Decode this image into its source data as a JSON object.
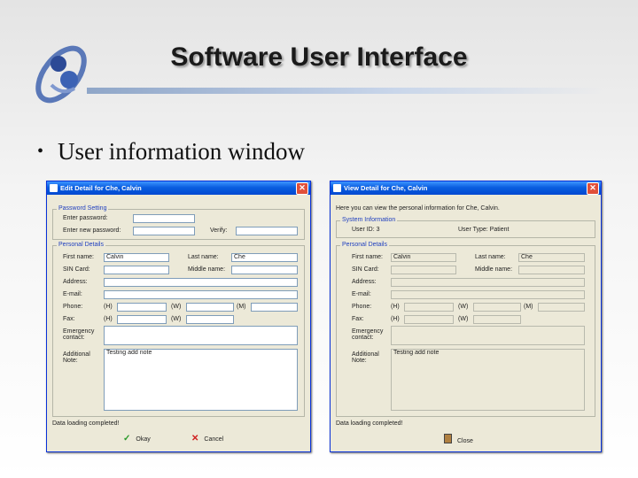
{
  "slide": {
    "title": "Software User Interface",
    "bullet": "User information window"
  },
  "edit_window": {
    "title": "Edit Detail for Che, Calvin",
    "close_glyph": "✕",
    "password_group": "Password Setting",
    "enter_password_label": "Enter password:",
    "enter_password_value": "",
    "new_password_label": "Enter new password:",
    "new_password_value": "",
    "verify_label": "Verify:",
    "verify_value": "",
    "personal_group": "Personal Details",
    "first_name_label": "First name:",
    "first_name_value": "Calvin",
    "last_name_label": "Last name:",
    "last_name_value": "Che",
    "sin_label": "SIN Card:",
    "sin_value": "",
    "middle_name_label": "Middle name:",
    "middle_name_value": "",
    "address_label": "Address:",
    "address_value": "",
    "email_label": "E-mail:",
    "email_value": "",
    "phone_label": "Phone:",
    "fax_label": "Fax:",
    "h_tag": "(H)",
    "w_tag": "(W)",
    "m_tag": "(M)",
    "phone_h_value": "",
    "phone_w_value": "",
    "phone_m_value": "",
    "fax_h_value": "",
    "fax_w_value": "",
    "emergency_label": "Emergency contact:",
    "emergency_value": "",
    "additional_label": "Additional Note:",
    "additional_value": "Testing add note",
    "status": "Data loading completed!",
    "okay_label": "Okay",
    "cancel_label": "Cancel"
  },
  "view_window": {
    "title": "View Detail for Che, Calvin",
    "close_glyph": "✕",
    "intro": "Here you can view the personal information for Che, Calvin.",
    "system_group": "System Information",
    "user_id_label": "User ID: 3",
    "user_type_label": "User Type: Patient",
    "personal_group": "Personal Details",
    "first_name_label": "First name:",
    "first_name_value": "Calvin",
    "last_name_label": "Last name:",
    "last_name_value": "Che",
    "sin_label": "SIN Card:",
    "sin_value": "",
    "middle_name_label": "Middle name:",
    "middle_name_value": "",
    "address_label": "Address:",
    "address_value": "",
    "email_label": "E-mail:",
    "email_value": "",
    "phone_label": "Phone:",
    "fax_label": "Fax:",
    "h_tag": "(H)",
    "w_tag": "(W)",
    "m_tag": "(M)",
    "phone_h_value": "",
    "phone_w_value": "",
    "phone_m_value": "",
    "fax_h_value": "",
    "fax_w_value": "",
    "emergency_label": "Emergency contact:",
    "emergency_value": "",
    "additional_label": "Additional Note:",
    "additional_value": "Testing add note",
    "status": "Data loading completed!",
    "close_label": "Close"
  },
  "icons": {
    "logo": "sun-moon-logo",
    "okay": "check-icon",
    "cancel": "cross-icon",
    "close": "door-icon"
  },
  "colors": {
    "titlebar": "#0a5ee0",
    "accent_rule": "#8fa6c8",
    "window_bg": "#ece9d8"
  }
}
